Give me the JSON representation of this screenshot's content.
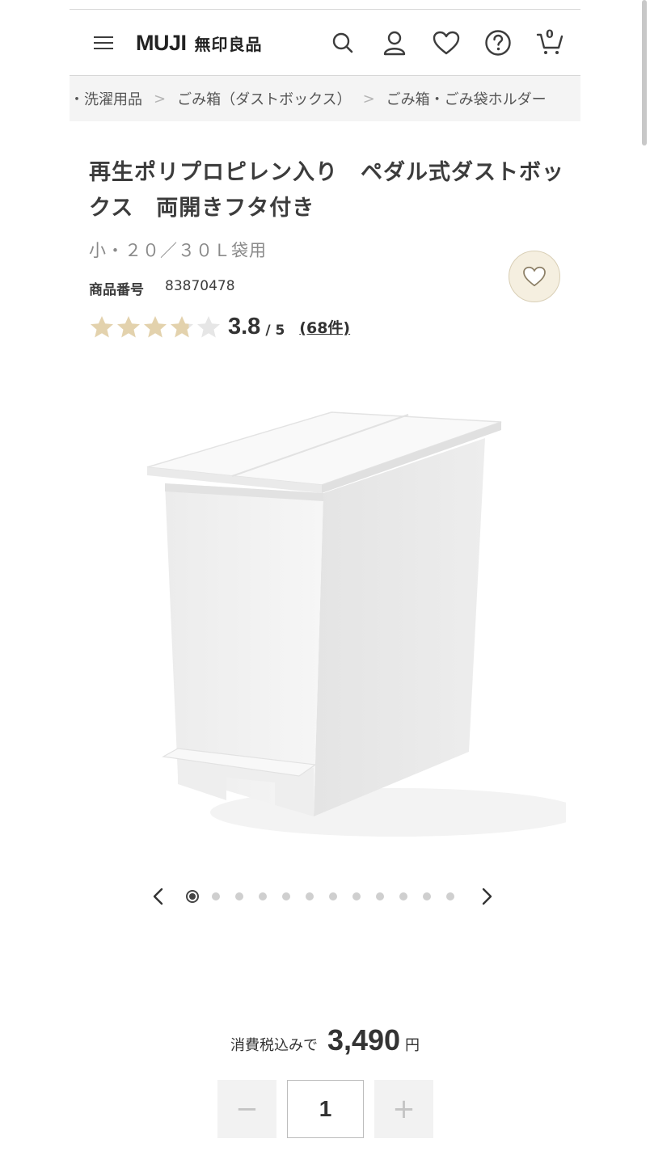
{
  "header": {
    "logo_en": "MUJI",
    "logo_jp": "無印良品",
    "cart_count": "0"
  },
  "breadcrumb": [
    "・洗濯用品",
    "ごみ箱（ダストボックス）",
    "ごみ箱・ごみ袋ホルダー"
  ],
  "product": {
    "title": "再生ポリプロピレン入り　ペダル式ダストボックス　両開きフタ付き",
    "subtitle": "小・２０／３０Ｌ袋用",
    "number_label": "商品番号",
    "number": "83870478",
    "rating": "3.8",
    "rating_max": "/ 5",
    "review_count": "(68件)",
    "rating_value": 3.8
  },
  "carousel": {
    "total_images": 12,
    "active_index": 0
  },
  "price": {
    "tax_label": "消費税込みで",
    "amount": "3,490",
    "currency": "円"
  },
  "quantity": {
    "minus": "−",
    "value": "1",
    "plus": "+"
  },
  "colors": {
    "star_filled": "#e3d2ad",
    "star_empty": "#e6e6e6",
    "favorite_bg": "#f5efe0",
    "text": "#3c3c3c"
  }
}
